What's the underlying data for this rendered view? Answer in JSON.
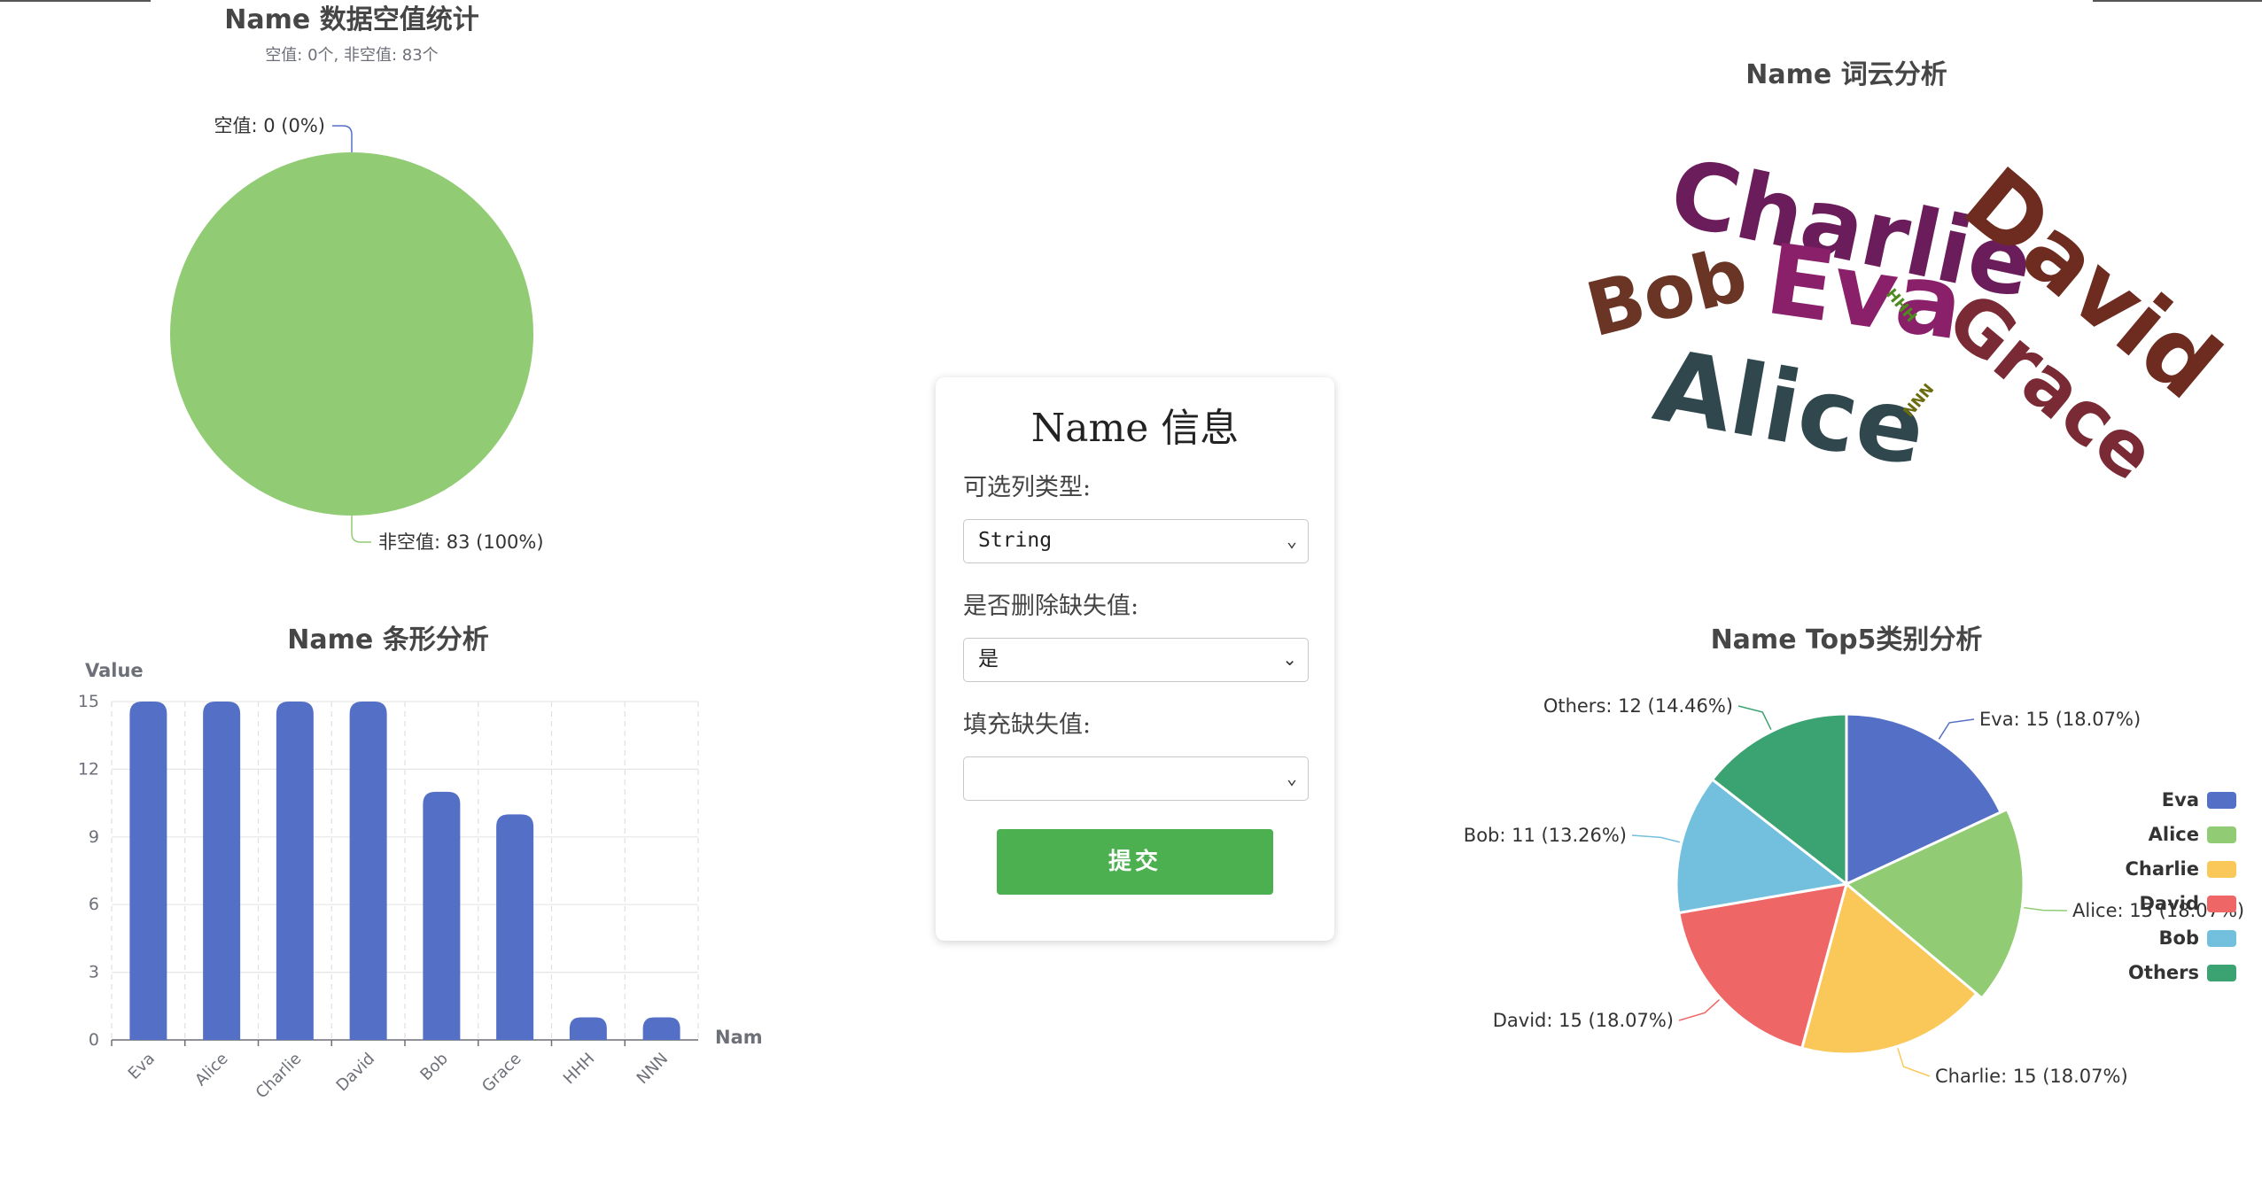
{
  "form": {
    "title": "Name 信息",
    "col_type_label": "可选列类型:",
    "col_type_value": "String",
    "drop_missing_label": "是否删除缺失值:",
    "drop_missing_value": "是",
    "fill_missing_label": "填充缺失值:",
    "fill_missing_value": "",
    "submit_label": "提交"
  },
  "colors": {
    "blue": "#5470c6",
    "green": "#91cc75",
    "yellow": "#fac858",
    "red": "#ee6666",
    "cyan": "#73c0de",
    "teal": "#3ba272"
  },
  "chart_data": [
    {
      "id": "null-stats",
      "type": "pie",
      "title": "Name 数据空值统计",
      "subtitle": "空值: 0个, 非空值: 83个",
      "slices": [
        {
          "name": "空值",
          "value": 0,
          "label": "空值: 0 (0%)"
        },
        {
          "name": "非空值",
          "value": 83,
          "label": "非空值: 83 (100%)"
        }
      ]
    },
    {
      "id": "wordcloud",
      "type": "wordcloud",
      "title": "Name 词云分析",
      "words": [
        {
          "text": "Charlie",
          "weight": 15,
          "color": "#6b1c5a"
        },
        {
          "text": "David",
          "weight": 15,
          "color": "#6e2b20"
        },
        {
          "text": "Eva",
          "weight": 15,
          "color": "#8a1f6a"
        },
        {
          "text": "Alice",
          "weight": 15,
          "color": "#2f474d"
        },
        {
          "text": "Bob",
          "weight": 11,
          "color": "#6a3525"
        },
        {
          "text": "Grace",
          "weight": 10,
          "color": "#7a2a34"
        },
        {
          "text": "HHH",
          "weight": 1,
          "color": "#4f8a20"
        },
        {
          "text": "NNN",
          "weight": 1,
          "color": "#6b6b10"
        }
      ]
    },
    {
      "id": "bar",
      "type": "bar",
      "title": "Name 条形分析",
      "ylabel": "Value",
      "xlabel": "Nam",
      "categories": [
        "Eva",
        "Alice",
        "Charlie",
        "David",
        "Bob",
        "Grace",
        "HHH",
        "NNN"
      ],
      "values": [
        15,
        15,
        15,
        15,
        11,
        10,
        1,
        1
      ],
      "ylim": [
        0,
        15
      ],
      "yticks": [
        "0",
        "3",
        "6",
        "9",
        "12",
        "15"
      ],
      "grid": true
    },
    {
      "id": "top5",
      "type": "pie",
      "title": "Name Top5类别分析",
      "legend_position": "right",
      "slices": [
        {
          "name": "Eva",
          "value": 15,
          "label": "Eva: 15 (18.07%)"
        },
        {
          "name": "Alice",
          "value": 15,
          "label": "Alice: 15 (18.07%)"
        },
        {
          "name": "Charlie",
          "value": 15,
          "label": "Charlie: 15 (18.07%)"
        },
        {
          "name": "David",
          "value": 15,
          "label": "David: 15 (18.07%)"
        },
        {
          "name": "Bob",
          "value": 11,
          "label": "Bob: 11 (13.26%)"
        },
        {
          "name": "Others",
          "value": 12,
          "label": "Others: 12 (14.46%)"
        }
      ]
    }
  ]
}
